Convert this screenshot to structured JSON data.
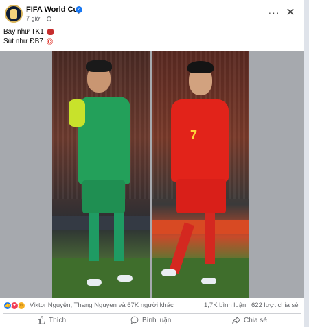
{
  "post": {
    "page_name": "FIFA World Cup",
    "time": "7 giờ",
    "caption_line1": "Bay như TK1",
    "caption_line2": "Sút như ĐB7"
  },
  "header": {
    "more_label": "···",
    "close_label": "✕"
  },
  "icons": {
    "verified": "verified-badge-icon",
    "privacy": "globe-icon",
    "caption_emoji1": "goalkeeper-glove-emoji",
    "caption_emoji2": "target-emoji"
  },
  "media": {
    "left_player_number": "",
    "right_player_number": "7"
  },
  "reactions": {
    "names": "Viktor Nguyễn, Thang Nguyen và 67K người khác",
    "comments": "1,7K bình luận",
    "shares": "622 lượt chia sẻ"
  },
  "actions": {
    "like": "Thích",
    "comment": "Bình luận",
    "share": "Chia sẻ"
  },
  "colors": {
    "brand_blue": "#1877f2",
    "secondary_text": "#65676b",
    "keeper_kit": "#23a05a",
    "striker_kit": "#e2231a"
  }
}
